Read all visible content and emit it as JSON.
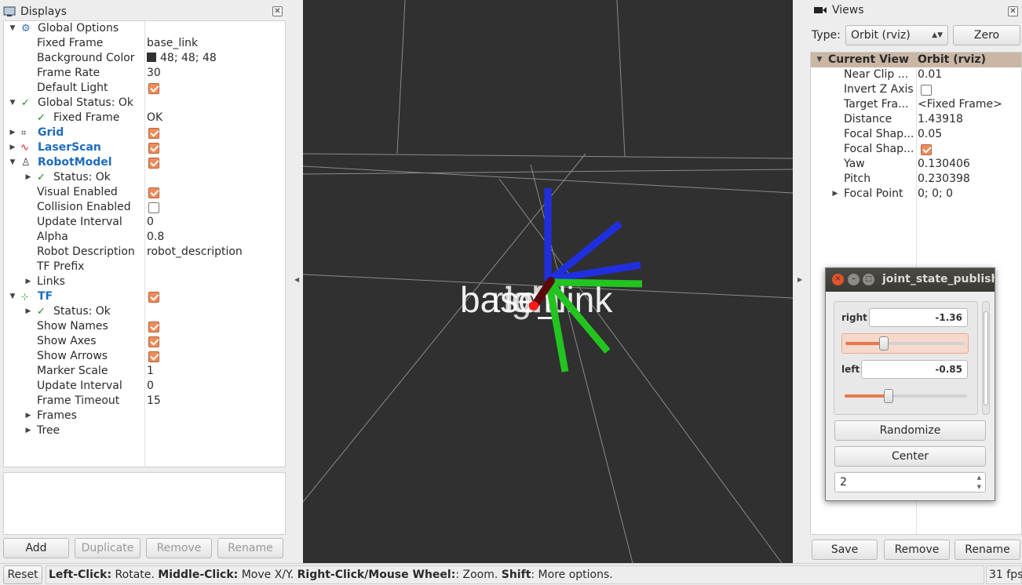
{
  "displays": {
    "title": "Displays",
    "rows": {
      "global_options": {
        "label": "Global Options"
      },
      "fixed_frame": {
        "label": "Fixed Frame",
        "value": "base_link"
      },
      "background_color": {
        "label": "Background Color",
        "value": "48; 48; 48"
      },
      "frame_rate": {
        "label": "Frame Rate",
        "value": "30"
      },
      "default_light": {
        "label": "Default Light"
      },
      "global_status": {
        "label": "Global Status: Ok"
      },
      "status_fixed_frame": {
        "label": "Fixed Frame",
        "value": "OK"
      },
      "grid": {
        "label": "Grid"
      },
      "laserscan": {
        "label": "LaserScan"
      },
      "robotmodel": {
        "label": "RobotModel"
      },
      "rm_status": {
        "label": "Status: Ok"
      },
      "visual_enabled": {
        "label": "Visual Enabled"
      },
      "collision_enabled": {
        "label": "Collision Enabled"
      },
      "rm_update_interval": {
        "label": "Update Interval",
        "value": "0"
      },
      "alpha": {
        "label": "Alpha",
        "value": "0.8"
      },
      "robot_description": {
        "label": "Robot Description",
        "value": "robot_description"
      },
      "tf_prefix": {
        "label": "TF Prefix"
      },
      "links": {
        "label": "Links"
      },
      "tf": {
        "label": "TF"
      },
      "tf_status": {
        "label": "Status: Ok"
      },
      "show_names": {
        "label": "Show Names"
      },
      "show_axes": {
        "label": "Show Axes"
      },
      "show_arrows": {
        "label": "Show Arrows"
      },
      "marker_scale": {
        "label": "Marker Scale",
        "value": "1"
      },
      "tf_update_interval": {
        "label": "Update Interval",
        "value": "0"
      },
      "frame_timeout": {
        "label": "Frame Timeout",
        "value": "15"
      },
      "frames": {
        "label": "Frames"
      },
      "tree": {
        "label": "Tree"
      }
    },
    "buttons": {
      "add": "Add",
      "duplicate": "Duplicate",
      "remove": "Remove",
      "rename": "Rename"
    }
  },
  "viewport": {
    "frame_labels": [
      "base_link",
      "right",
      "left"
    ],
    "background": "#303030"
  },
  "views": {
    "title": "Views",
    "type_label": "Type:",
    "type_value": "Orbit (rviz)",
    "zero_label": "Zero",
    "header": {
      "label": "Current View",
      "value": "Orbit (rviz)"
    },
    "rows": [
      {
        "label": "Near Clip ...",
        "value": "0.01"
      },
      {
        "label": "Invert Z Axis",
        "value": ""
      },
      {
        "label": "Target Fra...",
        "value": "<Fixed Frame>"
      },
      {
        "label": "Distance",
        "value": "1.43918"
      },
      {
        "label": "Focal Shap...",
        "value": "0.05"
      },
      {
        "label": "Focal Shap...",
        "value": ""
      },
      {
        "label": "Yaw",
        "value": "0.130406"
      },
      {
        "label": "Pitch",
        "value": "0.230398"
      },
      {
        "label": "Focal Point",
        "value": "0; 0; 0"
      }
    ],
    "buttons": {
      "save": "Save",
      "remove": "Remove",
      "rename": "Rename"
    }
  },
  "joint_state_publisher": {
    "title": "joint_state_publisher",
    "right": {
      "label": "right",
      "value": "-1.36",
      "slider_fraction": 0.32
    },
    "left": {
      "label": "left",
      "value": "-0.85",
      "slider_fraction": 0.36
    },
    "randomize_label": "Randomize",
    "center_label": "Center",
    "spin_value": "2"
  },
  "statusbar": {
    "reset_label": "Reset",
    "help": [
      {
        "key": "Left-Click:",
        "text": " Rotate. "
      },
      {
        "key": "Middle-Click:",
        "text": " Move X/Y. "
      },
      {
        "key": "Right-Click/Mouse Wheel:",
        "text": ": Zoom. "
      },
      {
        "key": "Shift",
        "text": ": More options."
      }
    ],
    "fps": "31 fps"
  },
  "colors": {
    "accent_orange": "#ef8c5b",
    "link_blue": "#1e6bbd",
    "ok_green": "#1a8a1a",
    "axis_x": "#1f2fe0",
    "axis_y": "#22c41f",
    "axis_z": "#1f2fe0",
    "link_rod": "#5a0a0a",
    "joint_marker": "#ff1a1a"
  }
}
